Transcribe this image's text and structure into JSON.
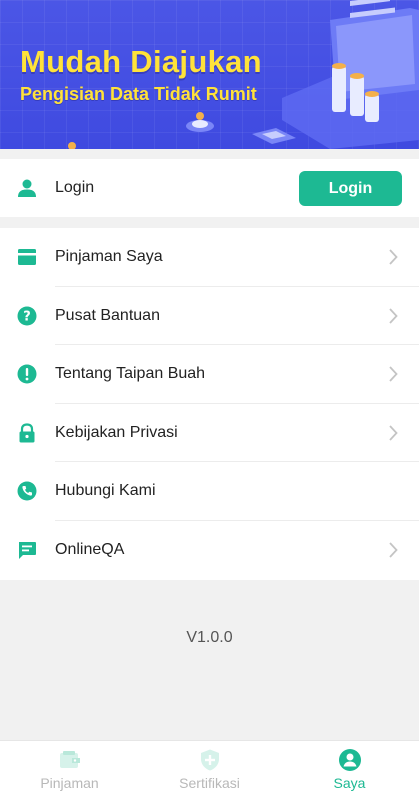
{
  "banner": {
    "title": "Mudah Diajukan",
    "subtitle": "Pengisian Data Tidak Rumit"
  },
  "login_card": {
    "label": "Login",
    "button_label": "Login",
    "icon": "user-icon"
  },
  "menu": {
    "items": [
      {
        "label": "Pinjaman Saya",
        "icon": "card-icon",
        "chevron": true
      },
      {
        "label": "Pusat Bantuan",
        "icon": "help-icon",
        "chevron": true
      },
      {
        "label": "Tentang Taipan Buah",
        "icon": "info-icon",
        "chevron": true
      },
      {
        "label": "Kebijakan Privasi",
        "icon": "lock-icon",
        "chevron": true
      },
      {
        "label": "Hubungi Kami",
        "icon": "phone-icon",
        "chevron": false
      },
      {
        "label": "OnlineQA",
        "icon": "chat-icon",
        "chevron": true
      }
    ]
  },
  "version": "V1.0.0",
  "tabbar": {
    "tabs": [
      {
        "label": "Pinjaman",
        "icon": "wallet-icon",
        "active": false
      },
      {
        "label": "Sertifikasi",
        "icon": "shield-plus-icon",
        "active": false
      },
      {
        "label": "Saya",
        "icon": "profile-icon",
        "active": true
      }
    ]
  },
  "colors": {
    "accent": "#1db993",
    "banner_bg": "#4b56e6",
    "banner_text": "#ffe23a",
    "inactive_tab": "#b8b8b8"
  }
}
